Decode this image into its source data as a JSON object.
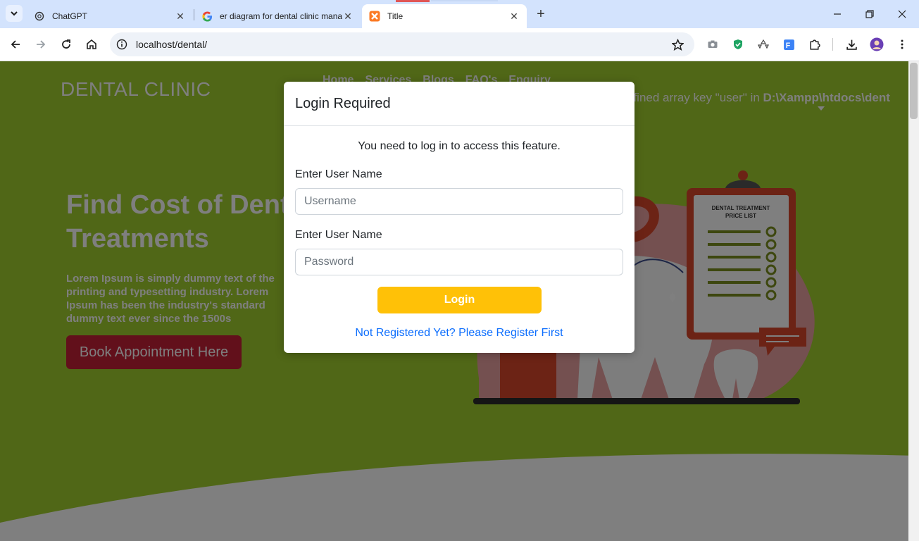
{
  "browser": {
    "tabs": [
      {
        "title": "ChatGPT",
        "icon": "chatgpt-icon",
        "active": false
      },
      {
        "title": "er diagram for dental clinic management",
        "icon": "google-icon",
        "active": false
      },
      {
        "title": "Title",
        "icon": "xampp-icon",
        "active": true
      }
    ],
    "url": "localhost/dental/"
  },
  "page": {
    "brand": "DENTAL CLINIC",
    "nav": [
      "Home",
      "Services",
      "Blogs",
      "FAQ's",
      "Enquiry"
    ],
    "warning_prefix": "efined array key \"user\" in ",
    "warning_path": "D:\\Xampp\\htdocs\\dent",
    "hero_title": "Find Cost of Dental Treatments",
    "hero_text": "Lorem Ipsum is simply dummy text of the printing and typesetting industry. Lorem Ipsum has been the industry's standard dummy text ever since the 1500s",
    "book_button": "Book Appointment Here",
    "illustration_text": "DENTAL TREATMENT PRICE LIST"
  },
  "modal": {
    "title": "Login Required",
    "message": "You need to log in to access this feature.",
    "username_label": "Enter User Name",
    "username_placeholder": "Username",
    "password_label": "Enter User Name",
    "password_placeholder": "Password",
    "login_button": "Login",
    "register_link": "Not Registered Yet? Please Register First"
  },
  "colors": {
    "page_bg": "#a0ce2e",
    "modal_login": "#ffc107",
    "book_button": "#c42037",
    "link": "#0d6efd"
  }
}
